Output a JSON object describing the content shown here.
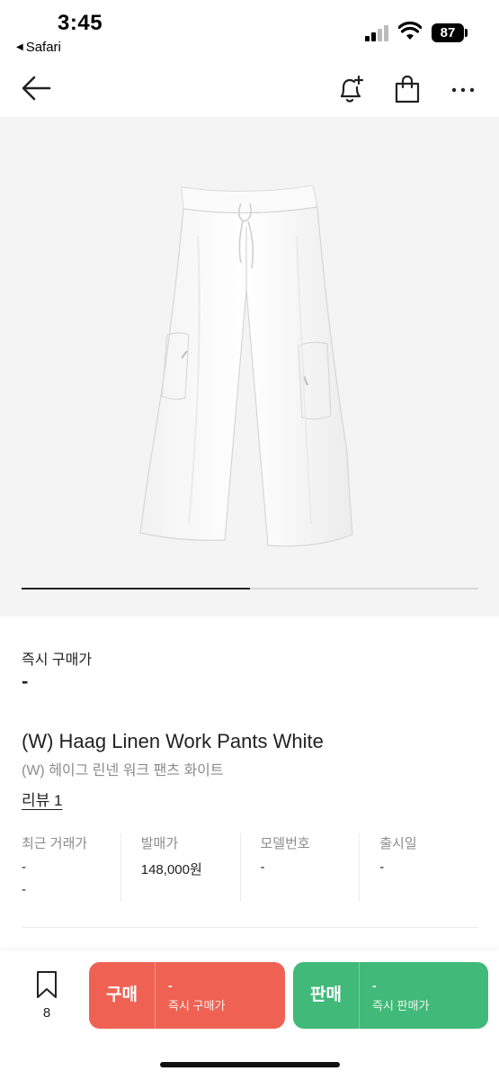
{
  "status_bar": {
    "time": "3:45",
    "back_app": "Safari",
    "battery": "87"
  },
  "nav": {
    "icons": [
      "back-arrow-icon",
      "bell-plus-icon",
      "shopping-bag-icon",
      "more-icon"
    ]
  },
  "gallery": {
    "progress": 0.5
  },
  "product": {
    "instant_price_label": "즉시 구매가",
    "instant_price_value": "-",
    "name_en": "(W) Haag Linen Work Pants White",
    "name_ko": "(W) 헤이그 린넨 워크 팬츠 화이트",
    "review_link": "리뷰 1"
  },
  "stats": [
    {
      "label": "최근 거래가",
      "value": "-",
      "value2": "-"
    },
    {
      "label": "발매가",
      "value": "148,000원"
    },
    {
      "label": "모델번호",
      "value": "-"
    },
    {
      "label": "출시일",
      "value": "-"
    }
  ],
  "bottom_bar": {
    "wish_count": "8",
    "buy": {
      "label": "구매",
      "price": "-",
      "caption": "즉시 구매가"
    },
    "sell": {
      "label": "판매",
      "price": "-",
      "caption": "즉시 판매가"
    }
  },
  "colors": {
    "buy": "#ef6253",
    "sell": "#41b979",
    "image_bg": "#f4f4f4"
  }
}
